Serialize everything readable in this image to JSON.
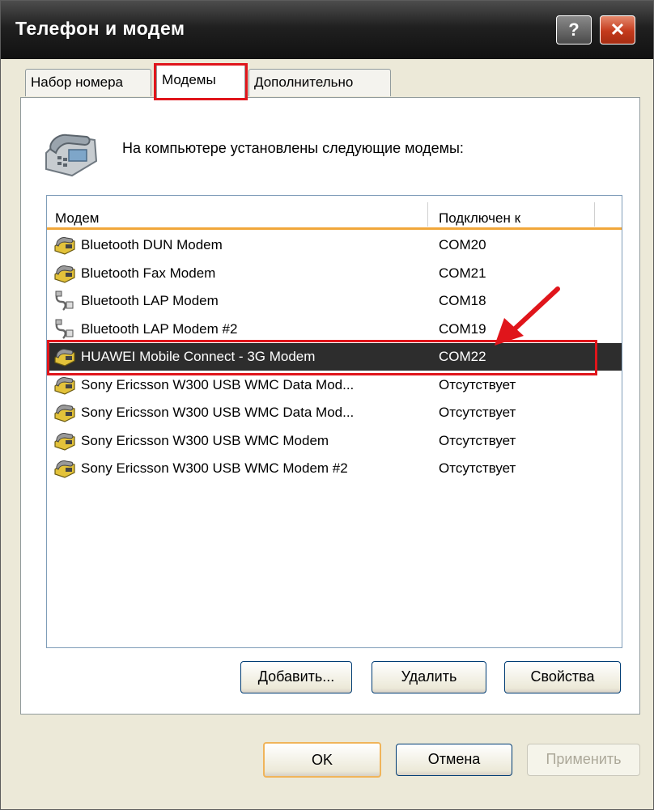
{
  "window": {
    "title": "Телефон и модем"
  },
  "titlebar": {
    "help": "?",
    "close": "✕"
  },
  "tabs": [
    {
      "label": "Набор номера"
    },
    {
      "label": "Модемы"
    },
    {
      "label": "Дополнительно"
    }
  ],
  "intro_text": "На компьютере установлены следующие модемы:",
  "list": {
    "columns": [
      "Модем",
      "Подключен к"
    ],
    "rows": [
      {
        "name": "Bluetooth DUN Modem",
        "port": "COM20",
        "icon": "modem-icon"
      },
      {
        "name": "Bluetooth Fax Modem",
        "port": "COM21",
        "icon": "modem-icon"
      },
      {
        "name": "Bluetooth LAP Modem",
        "port": "COM18",
        "icon": "cable-icon"
      },
      {
        "name": "Bluetooth LAP Modem #2",
        "port": "COM19",
        "icon": "cable-icon"
      },
      {
        "name": "HUAWEI Mobile Connect - 3G Modem",
        "port": "COM22",
        "icon": "modem-icon"
      },
      {
        "name": "Sony Ericsson W300 USB WMC Data Mod...",
        "port": "Отсутствует",
        "icon": "modem-icon"
      },
      {
        "name": "Sony Ericsson W300 USB WMC Data Mod...",
        "port": "Отсутствует",
        "icon": "modem-icon"
      },
      {
        "name": "Sony Ericsson W300 USB WMC Modem",
        "port": "Отсутствует",
        "icon": "modem-icon"
      },
      {
        "name": "Sony Ericsson W300 USB WMC Modem #2",
        "port": "Отсутствует",
        "icon": "modem-icon"
      }
    ],
    "selected_index": 4
  },
  "buttons": {
    "add": "Добавить...",
    "remove": "Удалить",
    "properties": "Свойства",
    "ok": "OK",
    "cancel": "Отмена",
    "apply": "Применить"
  },
  "colors": {
    "highlight": "#e0151b",
    "selection": "#2d2d2d",
    "header_underline": "#f1a73a"
  }
}
